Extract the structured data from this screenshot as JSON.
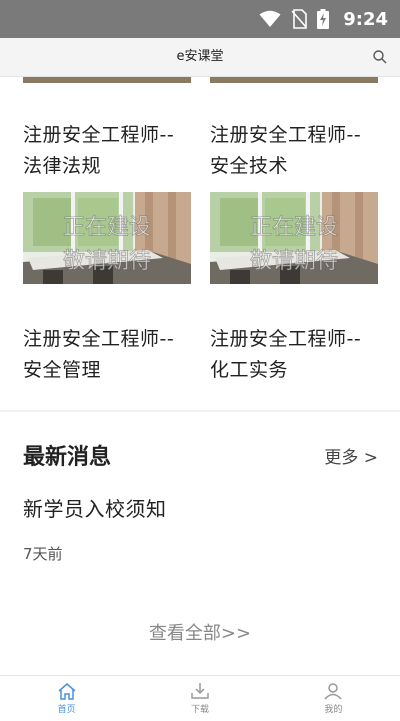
{
  "status_bar": {
    "time": "9:24"
  },
  "header": {
    "title": "e安课堂"
  },
  "courses": [
    {
      "title": "注册安全工程师--\n法律法规"
    },
    {
      "title": "注册安全工程师--\n安全技术"
    },
    {
      "title": "注册安全工程师--\n安全管理",
      "thumb_caption": [
        "正在建设",
        "敬请期待"
      ]
    },
    {
      "title": "注册安全工程师--\n化工实务",
      "thumb_caption": [
        "正在建设",
        "敬请期待"
      ]
    }
  ],
  "news": {
    "section_title": "最新消息",
    "more_label": "更多 >",
    "items": [
      {
        "title": "新学员入校须知",
        "time": "7天前"
      }
    ],
    "view_all": "查看全部>>"
  },
  "bottom_nav": [
    {
      "label": "首页",
      "icon": "home-icon",
      "active": true
    },
    {
      "label": "下载",
      "icon": "download-icon",
      "active": false
    },
    {
      "label": "我的",
      "icon": "user-icon",
      "active": false
    }
  ],
  "colors": {
    "status_bar": "#7a7a7a",
    "accent": "#4a90d9",
    "header_bg": "#f4f4f4"
  }
}
